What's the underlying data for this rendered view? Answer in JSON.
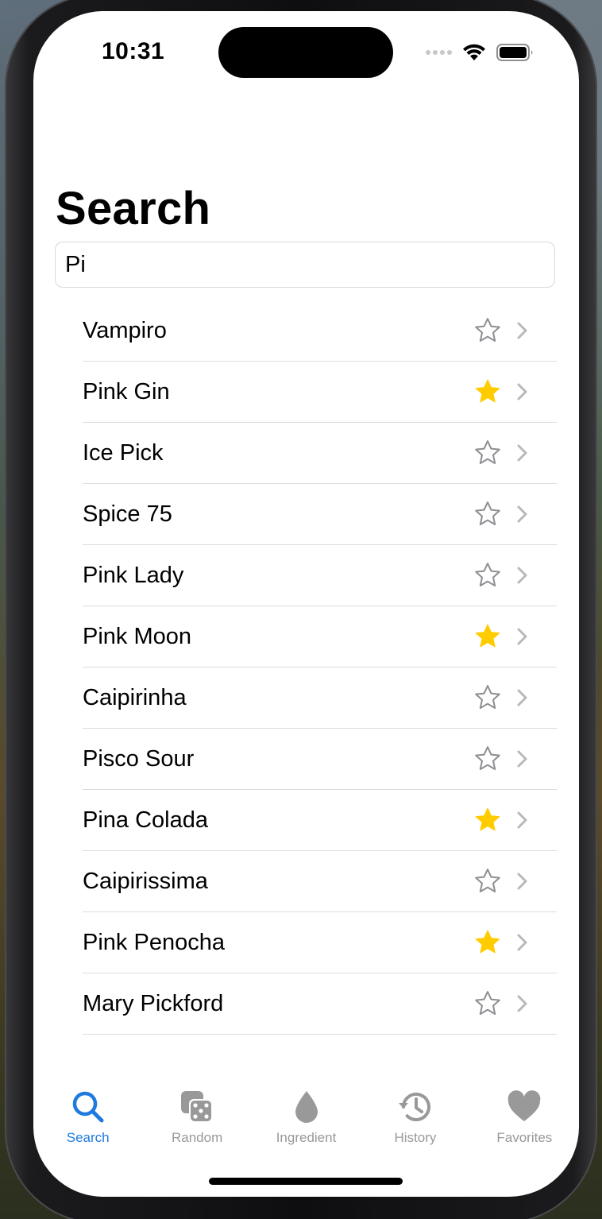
{
  "status_bar": {
    "time": "10:31"
  },
  "page": {
    "title": "Search"
  },
  "search": {
    "value": "Pi",
    "placeholder": ""
  },
  "colors": {
    "accent": "#1f7ae0",
    "favorite_star": "#ffcc00",
    "inactive": "#999999"
  },
  "results": [
    {
      "name": "Vampiro",
      "favorite": false
    },
    {
      "name": "Pink Gin",
      "favorite": true
    },
    {
      "name": "Ice Pick",
      "favorite": false
    },
    {
      "name": "Spice 75",
      "favorite": false
    },
    {
      "name": "Pink Lady",
      "favorite": false
    },
    {
      "name": "Pink Moon",
      "favorite": true
    },
    {
      "name": "Caipirinha",
      "favorite": false
    },
    {
      "name": "Pisco Sour",
      "favorite": false
    },
    {
      "name": "Pina Colada",
      "favorite": true
    },
    {
      "name": "Caipirissima",
      "favorite": false
    },
    {
      "name": "Pink Penocha",
      "favorite": true
    },
    {
      "name": "Mary Pickford",
      "favorite": false
    }
  ],
  "tabs": [
    {
      "label": "Search",
      "icon": "magnifying-glass-icon",
      "active": true
    },
    {
      "label": "Random",
      "icon": "dice-icon",
      "active": false
    },
    {
      "label": "Ingredient",
      "icon": "drop-icon",
      "active": false
    },
    {
      "label": "History",
      "icon": "clock-history-icon",
      "active": false
    },
    {
      "label": "Favorites",
      "icon": "heart-icon",
      "active": false
    }
  ]
}
